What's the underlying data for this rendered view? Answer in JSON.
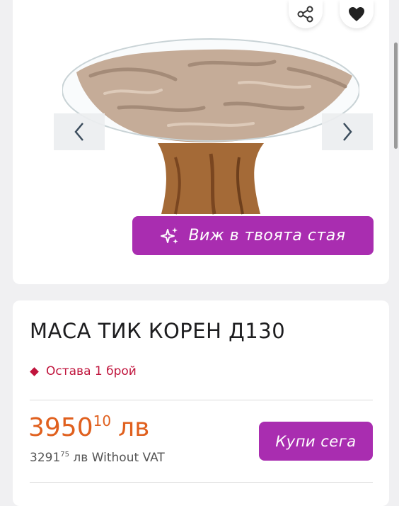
{
  "gallery": {
    "image_alt": "product-photo-teak-root-table",
    "share_icon": "share-icon",
    "favorite_icon": "heart-icon",
    "prev_icon": "chevron-left-icon",
    "next_icon": "chevron-right-icon",
    "ar_icon": "sparkles-icon",
    "ar_label": "Виж в твоята стая"
  },
  "product": {
    "title": "МАСА ТИК КОРЕН Д130",
    "stock_status": "Остава 1 брой",
    "price_main": "3950",
    "price_cents": "10",
    "currency": "лв",
    "price_no_vat_main": "3291",
    "price_no_vat_cents": "75",
    "price_no_vat_suffix": "лв Without VAT",
    "buy_label": "Купи сега"
  },
  "colors": {
    "accent": "#a92db0",
    "price": "#e0601e",
    "stock": "#c0143c"
  }
}
